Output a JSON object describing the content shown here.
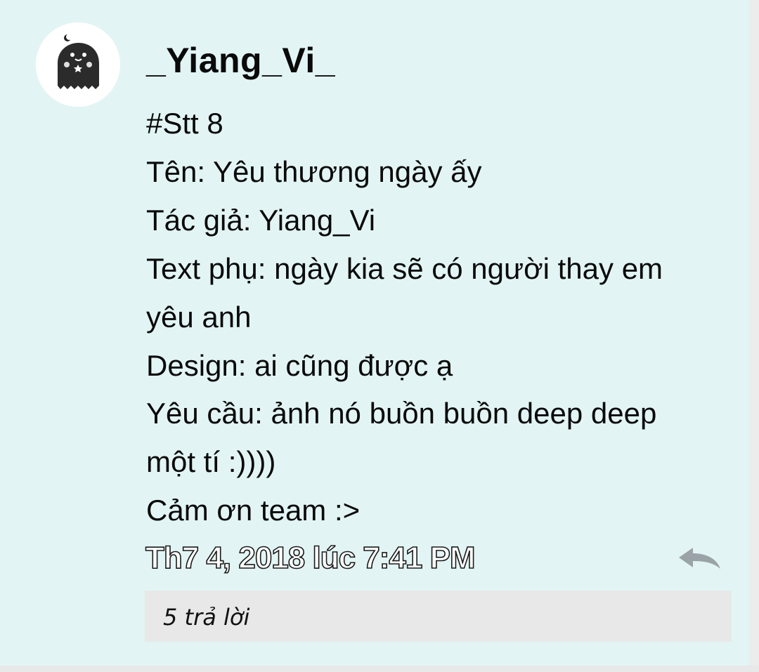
{
  "post": {
    "author": "_Yiang_Vi_",
    "avatar_icon": "ghost-avatar-icon",
    "lines": [
      "#Stt 8",
      "Tên: Yêu thương ngày ấy",
      "Tác giả: Yiang_Vi",
      "Text phụ: ngày kia sẽ có người thay em",
      "yêu anh",
      "Design: ai cũng được ạ",
      "Yêu cầu: ảnh nó buồn buồn deep deep",
      "một tí :))))",
      "Cảm ơn team :>"
    ],
    "timestamp": "Th7 4, 2018 lúc 7:41 PM",
    "reply_icon": "reply-arrow-icon",
    "replies_label": "5 trả lời"
  },
  "colors": {
    "background": "#e2f5f4",
    "replies_box": "#e8e8e8",
    "reply_icon": "#9aa3a8",
    "text": "#0a0a0a"
  }
}
